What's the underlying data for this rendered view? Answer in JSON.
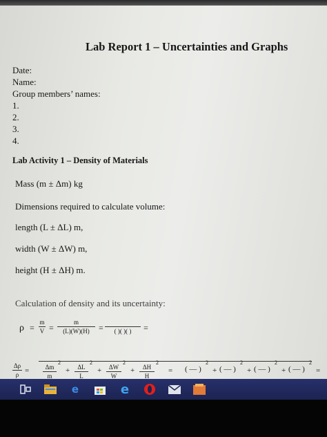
{
  "document": {
    "title": "Lab Report 1 – Uncertainties and Graphs",
    "fields": {
      "date": "Date:",
      "name": "Name:",
      "group": "Group members’ names:",
      "members": [
        "1.",
        "2.",
        "3.",
        "4."
      ]
    },
    "activity": {
      "heading": "Lab Activity 1 – Density of Materials",
      "mass": "Mass  (m ± Δm) kg",
      "dimensions": "Dimensions required to calculate volume:",
      "length": "length (L ± ΔL) m,",
      "width": "width (W ± ΔW) m,",
      "height": "height (H ± ΔH) m.",
      "calc": "Calculation of density and its uncertainty:"
    },
    "formula1": {
      "lhs": "ρ",
      "eq": "=",
      "m": "m",
      "v": "V",
      "lwh": "(L)(W)(H)",
      "blank": "(   )(   )(   )"
    },
    "formula2": {
      "lhs_num": "Δρ",
      "lhs_den": "ρ",
      "dm": "Δm",
      "m": "m",
      "dl": "ΔL",
      "l": "L",
      "dw": "ΔW",
      "w": "W",
      "dh": "ΔH",
      "h": "H",
      "sq": "2",
      "plus": "+",
      "blank": "( — )"
    }
  },
  "taskbar": {
    "icons": [
      "task-view-icon",
      "file-explorer-icon",
      "edge-icon",
      "store-icon",
      "internet-explorer-icon",
      "opera-icon",
      "mail-icon",
      "app-icon"
    ]
  }
}
